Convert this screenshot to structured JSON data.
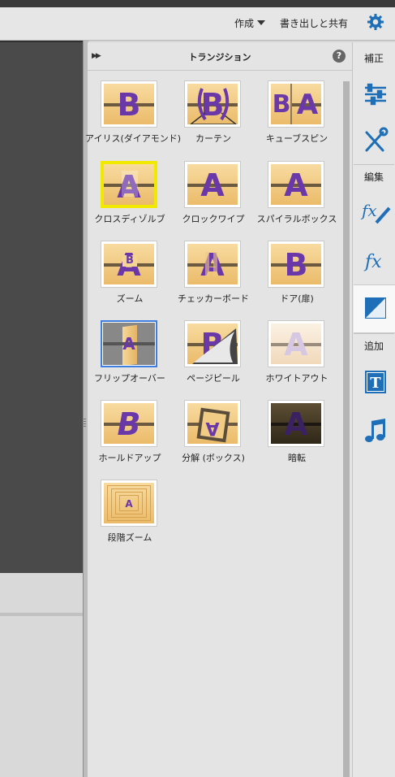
{
  "header": {
    "create_label": "作成",
    "share_label": "書き出しと共有",
    "settings_icon": "gear-icon",
    "accent_color": "#1e6fb8"
  },
  "panel": {
    "title": "トランジション",
    "expand_icon": "double-chevron-right-icon",
    "help_label": "?"
  },
  "transitions": [
    {
      "label": "アイリス(ダイアモンド)",
      "icon_letter": "B"
    },
    {
      "label": "カーテン",
      "icon_letter": "B"
    },
    {
      "label": "キューブスピン",
      "icon_letter": "A",
      "icon_letter_2": "B"
    },
    {
      "label": "クロスディゾルブ",
      "icon_letter": "A",
      "selected": "yellow"
    },
    {
      "label": "クロックワイプ",
      "icon_letter": "A"
    },
    {
      "label": "スパイラルボックス",
      "icon_letter": "A"
    },
    {
      "label": "ズーム",
      "icon_letter": "A",
      "icon_letter_2": "B"
    },
    {
      "label": "チェッカーボード",
      "icon_letter": "A"
    },
    {
      "label": "ドア(扉)",
      "icon_letter": "B"
    },
    {
      "label": "フリップオーバー",
      "icon_letter": "A",
      "selected": "blue"
    },
    {
      "label": "ページピール",
      "icon_letter": "B"
    },
    {
      "label": "ホワイトアウト",
      "icon_letter": "A"
    },
    {
      "label": "ホールドアップ",
      "icon_letter": "B"
    },
    {
      "label": "分解 (ボックス)",
      "icon_letter": "A"
    },
    {
      "label": "暗転",
      "icon_letter": "A"
    },
    {
      "label": "段階ズーム",
      "icon_letter": "A"
    }
  ],
  "sidebar": {
    "section_adjust": "補正",
    "section_edit": "編集",
    "section_add": "追加",
    "icons": [
      "adjust-sliders-icon",
      "tools-icon",
      "fx-edit-icon",
      "fx-icon",
      "transitions-icon",
      "title-text-icon",
      "music-note-icon"
    ]
  }
}
